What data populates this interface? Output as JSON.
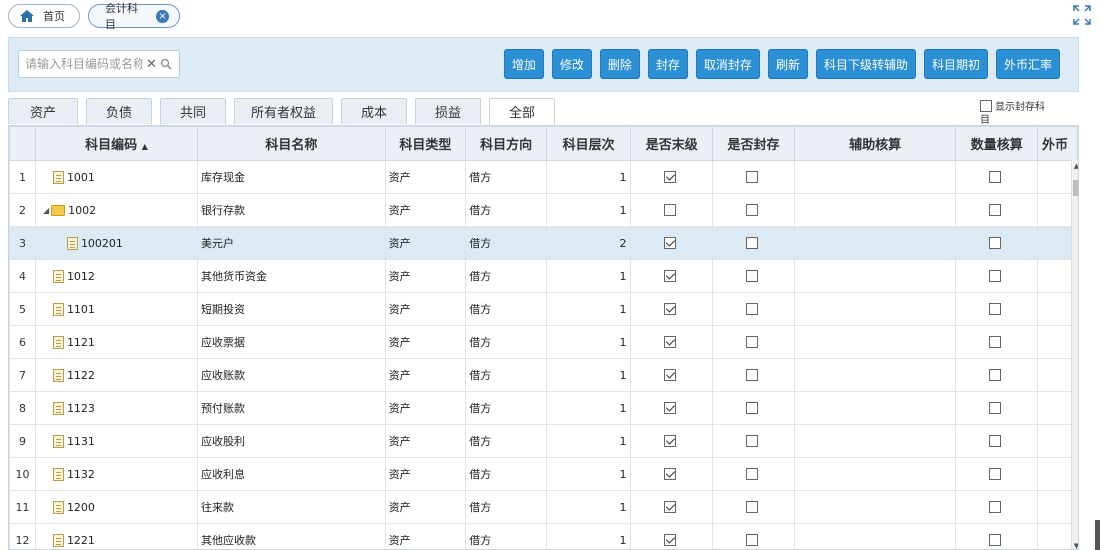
{
  "nav": {
    "home_label": "首页",
    "current_tab_label": "会计科目",
    "close_glyph": "×"
  },
  "toolbar": {
    "search_placeholder": "请输入科目编码或名称",
    "clear_glyph": "✕",
    "buttons": [
      {
        "key": "add",
        "label": "增加"
      },
      {
        "key": "edit",
        "label": "修改"
      },
      {
        "key": "delete",
        "label": "删除"
      },
      {
        "key": "seal",
        "label": "封存"
      },
      {
        "key": "unseal",
        "label": "取消封存"
      },
      {
        "key": "refresh",
        "label": "刷新"
      },
      {
        "key": "transfer-aux",
        "label": "科目下级转辅助"
      },
      {
        "key": "opening",
        "label": "科目期初"
      },
      {
        "key": "fx-rate",
        "label": "外币汇率"
      }
    ]
  },
  "tabs": [
    {
      "key": "asset",
      "label": "资产",
      "active": false
    },
    {
      "key": "liability",
      "label": "负债",
      "active": false
    },
    {
      "key": "common",
      "label": "共同",
      "active": false
    },
    {
      "key": "equity",
      "label": "所有者权益",
      "active": false
    },
    {
      "key": "cost",
      "label": "成本",
      "active": false
    },
    {
      "key": "pl",
      "label": "损益",
      "active": false
    },
    {
      "key": "all",
      "label": "全部",
      "active": true
    }
  ],
  "show_sealed": {
    "label": "显示封存科目",
    "checked": false
  },
  "grid": {
    "columns": {
      "code": "科目编码",
      "sort_glyph": "▲",
      "name": "科目名称",
      "type": "科目类型",
      "direction": "科目方向",
      "level": "科目层次",
      "is_leaf": "是否末级",
      "is_sealed": "是否封存",
      "aux": "辅助核算",
      "qty": "数量核算",
      "fx": "外币"
    },
    "rows": [
      {
        "n": "1",
        "code": "1001",
        "name": "库存现金",
        "type": "资产",
        "dir": "借方",
        "level": "1",
        "leaf": true,
        "sealed": false,
        "qty": false,
        "node": "leaf",
        "indent": 0,
        "selected": false
      },
      {
        "n": "2",
        "code": "1002",
        "name": "银行存款",
        "type": "资产",
        "dir": "借方",
        "level": "1",
        "leaf": false,
        "sealed": false,
        "qty": false,
        "node": "folder",
        "indent": 0,
        "selected": false
      },
      {
        "n": "3",
        "code": "100201",
        "name": "美元户",
        "type": "资产",
        "dir": "借方",
        "level": "2",
        "leaf": true,
        "sealed": false,
        "qty": false,
        "node": "leaf",
        "indent": 1,
        "selected": true
      },
      {
        "n": "4",
        "code": "1012",
        "name": "其他货币资金",
        "type": "资产",
        "dir": "借方",
        "level": "1",
        "leaf": true,
        "sealed": false,
        "qty": false,
        "node": "leaf",
        "indent": 0,
        "selected": false
      },
      {
        "n": "5",
        "code": "1101",
        "name": "短期投资",
        "type": "资产",
        "dir": "借方",
        "level": "1",
        "leaf": true,
        "sealed": false,
        "qty": false,
        "node": "leaf",
        "indent": 0,
        "selected": false
      },
      {
        "n": "6",
        "code": "1121",
        "name": "应收票据",
        "type": "资产",
        "dir": "借方",
        "level": "1",
        "leaf": true,
        "sealed": false,
        "qty": false,
        "node": "leaf",
        "indent": 0,
        "selected": false
      },
      {
        "n": "7",
        "code": "1122",
        "name": "应收账款",
        "type": "资产",
        "dir": "借方",
        "level": "1",
        "leaf": true,
        "sealed": false,
        "qty": false,
        "node": "leaf",
        "indent": 0,
        "selected": false
      },
      {
        "n": "8",
        "code": "1123",
        "name": "预付账款",
        "type": "资产",
        "dir": "借方",
        "level": "1",
        "leaf": true,
        "sealed": false,
        "qty": false,
        "node": "leaf",
        "indent": 0,
        "selected": false
      },
      {
        "n": "9",
        "code": "1131",
        "name": "应收股利",
        "type": "资产",
        "dir": "借方",
        "level": "1",
        "leaf": true,
        "sealed": false,
        "qty": false,
        "node": "leaf",
        "indent": 0,
        "selected": false
      },
      {
        "n": "10",
        "code": "1132",
        "name": "应收利息",
        "type": "资产",
        "dir": "借方",
        "level": "1",
        "leaf": true,
        "sealed": false,
        "qty": false,
        "node": "leaf",
        "indent": 0,
        "selected": false
      },
      {
        "n": "11",
        "code": "1200",
        "name": "往来款",
        "type": "资产",
        "dir": "借方",
        "level": "1",
        "leaf": true,
        "sealed": false,
        "qty": false,
        "node": "leaf",
        "indent": 0,
        "selected": false
      },
      {
        "n": "12",
        "code": "1221",
        "name": "其他应收款",
        "type": "资产",
        "dir": "借方",
        "level": "1",
        "leaf": true,
        "sealed": false,
        "qty": false,
        "node": "leaf",
        "indent": 0,
        "selected": false
      }
    ]
  },
  "colors": {
    "accent": "#2a8fd4",
    "toolbar_bg": "#ddebf6",
    "selected_row": "#dbeaf5"
  }
}
